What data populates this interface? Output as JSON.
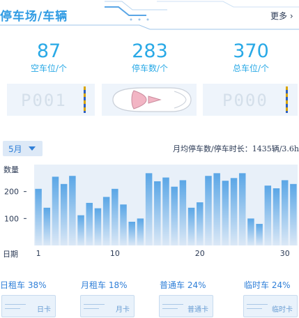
{
  "header": {
    "title": "停车场/车辆",
    "more_label": "更多 ›"
  },
  "stats": [
    {
      "value": "87",
      "label": "空车位/个"
    },
    {
      "value": "283",
      "label": "停车数/个"
    },
    {
      "value": "370",
      "label": "总车位/个"
    }
  ],
  "spaces": [
    {
      "plate": "P001"
    },
    {
      "plate": "P000"
    }
  ],
  "filters": {
    "month": "5月"
  },
  "summary": "月均停车数/停车时长：1435辆/3.6h",
  "chart_data": {
    "type": "bar",
    "ylabel": "数量",
    "xlabel": "日期",
    "x": [
      1,
      2,
      3,
      4,
      5,
      6,
      7,
      8,
      9,
      10,
      11,
      12,
      13,
      14,
      15,
      16,
      17,
      18,
      19,
      20,
      21,
      22,
      23,
      24,
      25,
      26,
      27,
      28,
      29,
      30,
      31
    ],
    "values": [
      210,
      140,
      255,
      228,
      258,
      112,
      158,
      138,
      180,
      210,
      152,
      88,
      100,
      268,
      238,
      252,
      218,
      242,
      140,
      160,
      258,
      268,
      240,
      250,
      268,
      100,
      80,
      222,
      212,
      242,
      228
    ],
    "xticks": [
      1,
      10,
      20,
      30
    ],
    "yticks": [
      100,
      200
    ],
    "ylim": [
      0,
      300
    ],
    "bar_color_top": "#5aa6e6",
    "bar_color_bottom": "#dbe8f6",
    "bg_color": "#e8f0f9"
  },
  "ticket_types": [
    {
      "label": "日租车",
      "percent": "38%",
      "card": "日卡"
    },
    {
      "label": "月租车",
      "percent": "18%",
      "card": "月卡"
    },
    {
      "label": "普通车",
      "percent": "24%",
      "card": "普通卡"
    },
    {
      "label": "临时车",
      "percent": "24%",
      "card": "临时卡"
    }
  ],
  "colors": {
    "accent": "#2f9be3",
    "stat": "#29a9e6",
    "text": "#2b3a55"
  }
}
